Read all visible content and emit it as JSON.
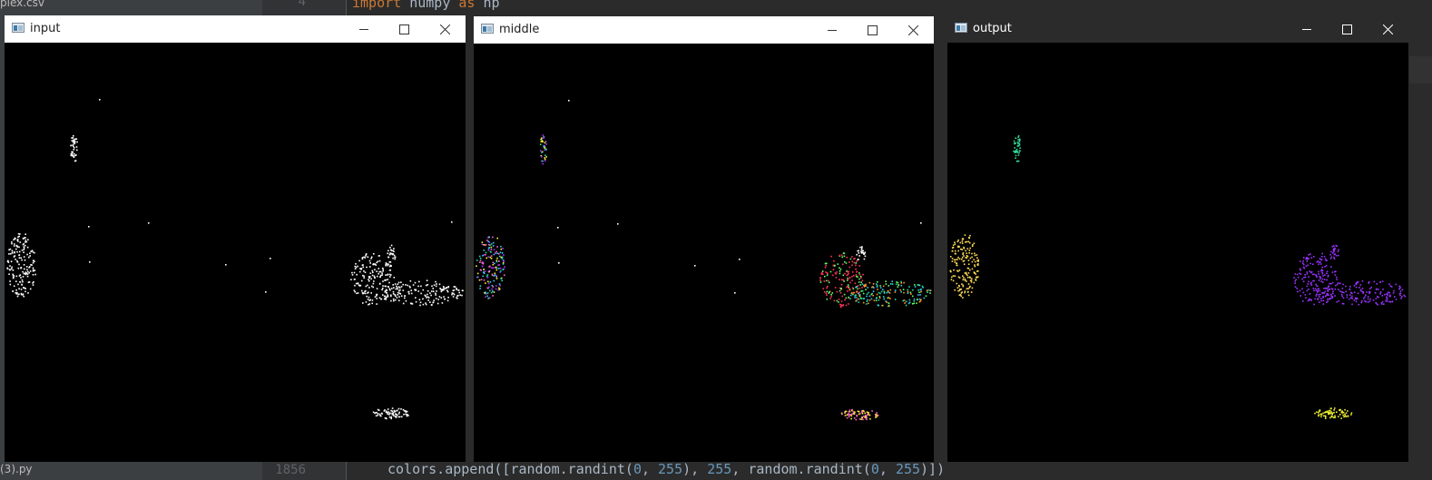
{
  "ide": {
    "file_top": "plex.csv",
    "file_bottom": "(3).py",
    "line_top": "4",
    "line_bottom": "1856",
    "code_top": {
      "kw1": "import",
      "mod": " numpy ",
      "kw2": "as",
      "alias": " np"
    },
    "code_bottom": {
      "a": "colors.append([random.randint(",
      "n1": "0",
      "b": ", ",
      "n2": "255",
      "c": "), ",
      "n3": "255",
      "d": ", random.randint(",
      "n4": "0",
      "e": ", ",
      "n5": "255",
      "f": ")])"
    }
  },
  "windows": [
    {
      "id": "input",
      "title": "input",
      "theme": "light"
    },
    {
      "id": "middle",
      "title": "middle",
      "theme": "light"
    },
    {
      "id": "output",
      "title": "output",
      "theme": "dark"
    }
  ],
  "icons": {
    "app": "opencv-window-icon",
    "minimize": "minimize-icon",
    "maximize": "maximize-icon",
    "close": "close-icon"
  },
  "colors": {
    "input_points": "#ffffff",
    "middle_clusters": [
      "#ff3355",
      "#22ddaa",
      "#aa33ff",
      "#ffee33",
      "#33ccff",
      "#ff66cc",
      "#66ff66",
      "#ff9922"
    ],
    "output_clusters": [
      "#33dd99",
      "#ffdd55",
      "#9933ff",
      "#eeee33"
    ]
  }
}
